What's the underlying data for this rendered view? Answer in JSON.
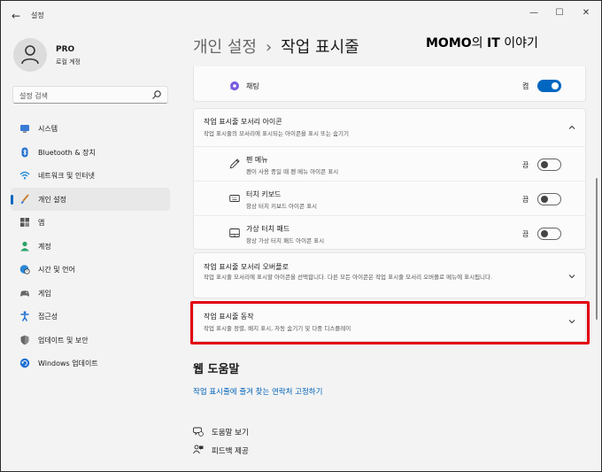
{
  "window": {
    "title": "설정",
    "minimize_glyph": "—",
    "maximize_glyph": "☐",
    "close_glyph": "✕",
    "back_glyph": "←"
  },
  "profile": {
    "name": "PRO",
    "subtitle": "로컬 계정"
  },
  "search": {
    "placeholder": "설정 검색"
  },
  "sidebar": {
    "items": [
      {
        "label": "시스템",
        "icon": "monitor-icon",
        "active": false
      },
      {
        "label": "Bluetooth & 장치",
        "icon": "bluetooth-icon",
        "active": false
      },
      {
        "label": "네트워크 및 인터넷",
        "icon": "wifi-icon",
        "active": false
      },
      {
        "label": "개인 설정",
        "icon": "brush-icon",
        "active": true
      },
      {
        "label": "앱",
        "icon": "apps-icon",
        "active": false
      },
      {
        "label": "계정",
        "icon": "person-icon",
        "active": false
      },
      {
        "label": "시간 및 언어",
        "icon": "globe-clock-icon",
        "active": false
      },
      {
        "label": "게임",
        "icon": "gamepad-icon",
        "active": false
      },
      {
        "label": "접근성",
        "icon": "accessibility-icon",
        "active": false
      },
      {
        "label": "업데이트 및 보안",
        "icon": "shield-icon",
        "active": false
      },
      {
        "label": "Windows 업데이트",
        "icon": "update-icon",
        "active": false
      }
    ]
  },
  "header": {
    "parent": "개인 설정",
    "separator": "›",
    "current": "작업 표시줄"
  },
  "watermark": {
    "bold": "MOMO",
    "rest_prefix": "의 ",
    "bold2": "IT",
    "rest": " 이야기"
  },
  "chat_row": {
    "label": "채팅",
    "state": "켬",
    "toggle_on": true
  },
  "corner_icons": {
    "title": "작업 표시줄 모서리 아이콘",
    "subtitle": "작업 표시줄의 모서리에 표시되는 아이콘을 표시 또는 숨기기",
    "items": [
      {
        "label": "펜 메뉴",
        "subtitle": "펜이 사용 중일 때 펜 메뉴 아이콘 표시",
        "state": "끔",
        "icon": "pen-icon",
        "toggle_on": false
      },
      {
        "label": "터치 키보드",
        "subtitle": "항상 터치 키보드 아이콘 표시",
        "state": "끔",
        "icon": "keyboard-icon",
        "toggle_on": false
      },
      {
        "label": "가상 터치 패드",
        "subtitle": "항상 가상 터치 패드 아이콘 표시",
        "state": "끔",
        "icon": "touchpad-icon",
        "toggle_on": false
      }
    ]
  },
  "corner_overflow": {
    "title": "작업 표시줄 모서리 오버플로",
    "subtitle": "작업 표시줄 모서리에 표시할 아이콘을 선택합니다. 다른 모든 아이콘은 작업 표시줄 모서리 오버플로 메뉴에 표시됩니다."
  },
  "behaviors": {
    "title": "작업 표시줄 동작",
    "subtitle": "작업 표시줄 정렬, 배지 표시, 자동 숨기기 및 다중 디스플레이"
  },
  "web_help": {
    "title": "웹 도움말",
    "link": "작업 표시줄에 즐겨 찾는 연락처 고정하기"
  },
  "footer": {
    "help": "도움말 보기",
    "feedback": "피드백 제공"
  },
  "colors": {
    "accent": "#0067c0",
    "highlight": "#e3000f",
    "link": "#0064b9"
  }
}
